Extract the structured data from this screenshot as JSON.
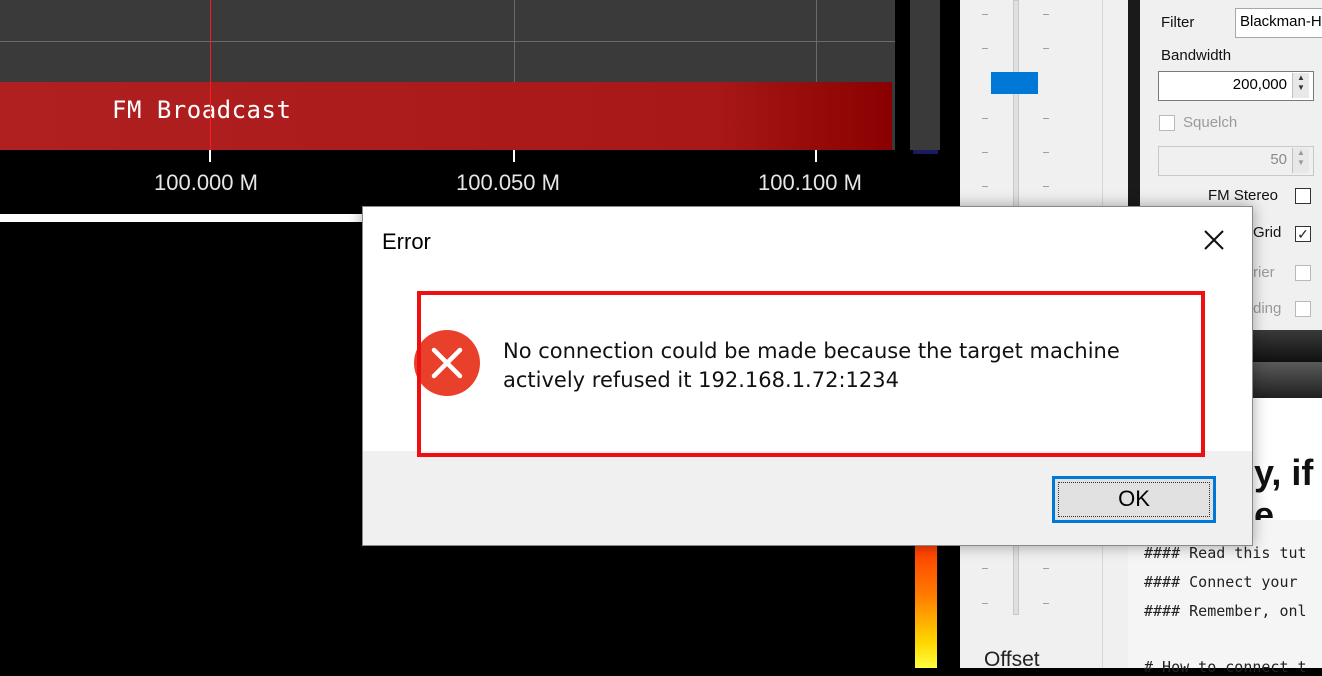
{
  "spectrum": {
    "band_label": "FM Broadcast",
    "freq_labels": [
      "100.000 M",
      "100.050 M",
      "100.100 M"
    ]
  },
  "slider_panel": {
    "offset_label": "Offset"
  },
  "settings": {
    "filter_label": "Filter",
    "filter_value": "Blackman-H",
    "bandwidth_label": "Bandwidth",
    "bandwidth_value": "200,000",
    "squelch_label": "Squelch",
    "squelch_checked": false,
    "squelch_value": "50",
    "fm_stereo_label": "FM Stereo",
    "fm_stereo_checked": false,
    "grid_label": "Grid",
    "grid_checked": true,
    "carrier_label": "rier",
    "snap_label": "ding"
  },
  "webpage": {
    "heading_fragment": "y, if e",
    "code_lines": [
      "#### Read this tut",
      "#### Connect your",
      "#### Remember, onl"
    ],
    "code_partial": "# How to connect t"
  },
  "dialog": {
    "title": "Error",
    "close_glyph": "close",
    "icon": "error-icon",
    "message_line1": "No connection could be made because the target machine",
    "message_line2": "actively refused it 192.168.1.72:1234",
    "ok_label": "OK"
  },
  "colors": {
    "band": "#a81818",
    "cursor": "#ff1a1a",
    "accent": "#0078d7",
    "highlight_box": "#ee1010",
    "error_icon": "#e8402a"
  }
}
